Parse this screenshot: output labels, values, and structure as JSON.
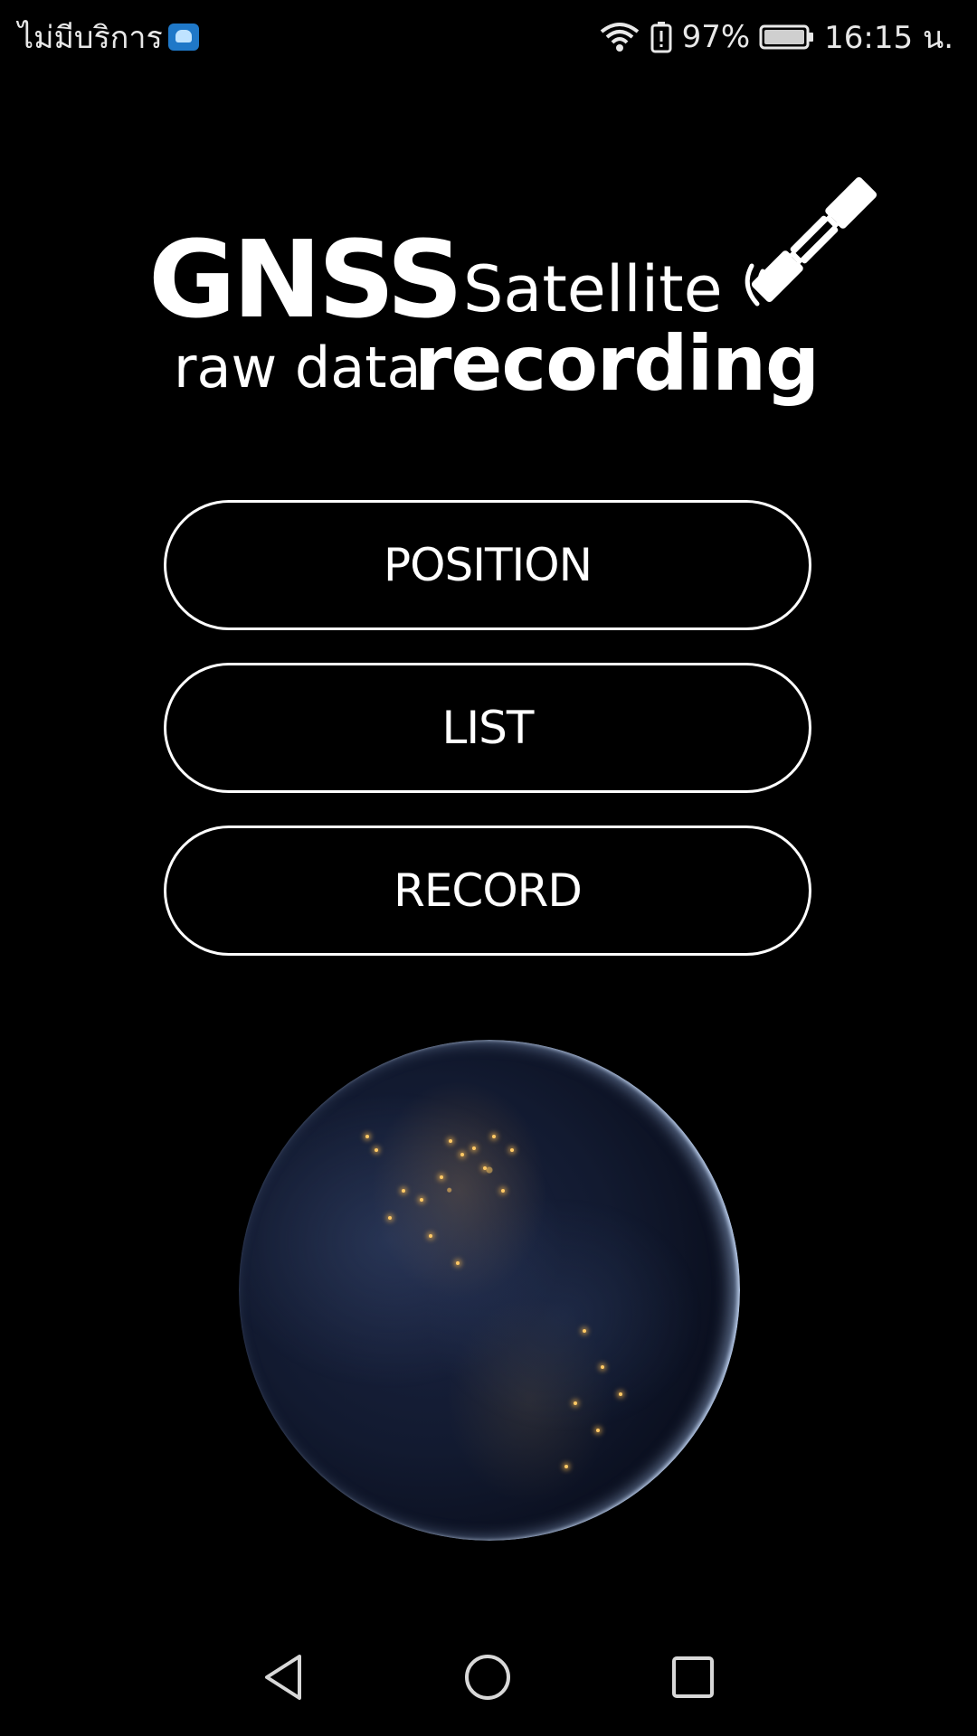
{
  "status_bar": {
    "carrier": "ไม่มีบริการ",
    "battery_percent": "97%",
    "time": "16:15 น.",
    "icons": [
      "carrier-app-icon",
      "wifi-icon",
      "battery-alert-icon",
      "battery-icon"
    ]
  },
  "logo": {
    "line1_bold": "GNSS",
    "line1_light": "Satellite",
    "line2_light": "raw data",
    "line2_bold": "recording",
    "icon": "satellite-icon"
  },
  "menu": {
    "position_label": "POSITION",
    "list_label": "LIST",
    "record_label": "RECORD"
  },
  "hero": {
    "icon": "earth-night-icon"
  },
  "nav": {
    "icons": [
      "back-icon",
      "home-icon",
      "recents-icon"
    ]
  },
  "colors": {
    "background": "#000000",
    "foreground": "#ffffff",
    "button_border": "#ffffff"
  }
}
